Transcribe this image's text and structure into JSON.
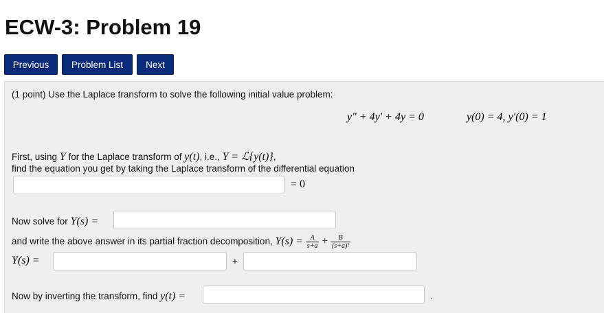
{
  "page": {
    "title": "ECW-3: Problem 19"
  },
  "nav": {
    "previous": "Previous",
    "problem_list": "Problem List",
    "next": "Next"
  },
  "problem": {
    "intro": "(1 point) Use the Laplace transform to solve the following initial value problem:",
    "ode": "y″ + 4y′ + 4y = 0",
    "initial_conditions": "y(0) = 4,  y′(0) = 1",
    "first_prefix": "First, using ",
    "first_Y": "Y",
    "first_mid": " for the Laplace transform of ",
    "first_yt": "y(t)",
    "first_ie": ", i.e., ",
    "first_def": "Y = ℒ{y(t)}",
    "first_end": ",",
    "find_eq": "find the equation you get by taking the Laplace transform of the differential equation",
    "eq_suffix": "= 0",
    "solve_prefix": "Now solve for ",
    "solve_math": "Y(s) =",
    "pfd_prefix": "and write the above answer in its partial fraction decomposition, ",
    "pfd_math": "Y(s) =",
    "frac1_num": "A",
    "frac1_den": "s+a",
    "plus": "+",
    "frac2_num": "B",
    "frac2_den": "(s+a)²",
    "ys_label": "Y(s) =",
    "plus2": "+",
    "invert_prefix": "Now by inverting the transform, find ",
    "invert_math": "y(t) =",
    "period": "."
  }
}
